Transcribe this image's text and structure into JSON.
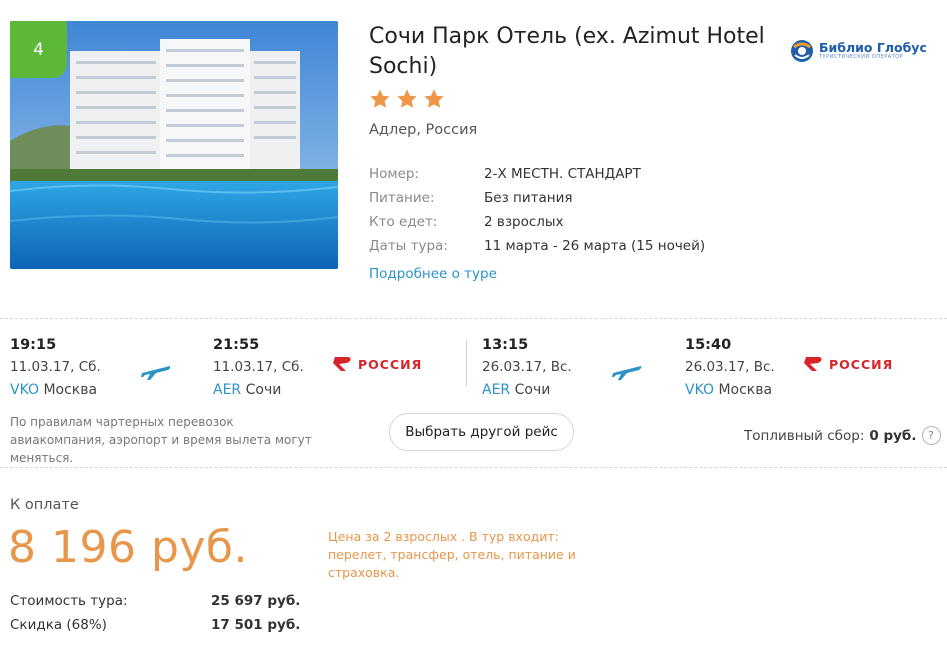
{
  "hotel": {
    "rank": "4",
    "name": "Сочи Парк Отель (ex. Azimut Hotel Sochi)",
    "stars": 3,
    "location": "Адлер, Россия",
    "details": [
      {
        "label": "Номер:",
        "value": "2-Х МЕСТН. СТАНДАРТ"
      },
      {
        "label": "Питание:",
        "value": "Без питания"
      },
      {
        "label": "Кто едет:",
        "value": "2 взрослых"
      },
      {
        "label": "Даты тура:",
        "value": "11 марта - 26 марта (15 ночей)"
      }
    ],
    "more_link": "Подробнее о туре"
  },
  "operator": {
    "name": "Библио Глобус",
    "subtitle": "ТУРИСТИЧЕСКИЙ ОПЕРАТОР",
    "brand_color": "#1f5ea8"
  },
  "flights": {
    "outbound": {
      "depart": {
        "time": "19:15",
        "date": "11.03.17, Сб.",
        "code": "VKO",
        "city": "Москва"
      },
      "arrive": {
        "time": "21:55",
        "date": "11.03.17, Сб.",
        "code": "AER",
        "city": "Сочи"
      },
      "airline": "РОССИЯ"
    },
    "return": {
      "depart": {
        "time": "13:15",
        "date": "26.03.17, Вс.",
        "code": "AER",
        "city": "Сочи"
      },
      "arrive": {
        "time": "15:40",
        "date": "26.03.17, Вс.",
        "code": "VKO",
        "city": "Москва"
      },
      "airline": "РОССИЯ"
    },
    "charter_note": "По правилам чартерных перевозок авиакомпания, аэропорт и время вылета могут меняться.",
    "change_button": "Выбрать другой рейс",
    "fuel_label": "Топливный сбор:",
    "fuel_value": "0 руб.",
    "help": "?"
  },
  "payment": {
    "label": "К оплате",
    "price": "8 196 руб.",
    "note": "Цена за 2 взрослых . В тур входит: перелет, трансфер, отель, питание и страховка.",
    "tour_cost_label": "Стоимость тура:",
    "tour_cost_value": "25 697 руб.",
    "discount_label": "Скидка (68%)",
    "discount_value": "17 501 руб.",
    "accent_color": "#e8964a"
  },
  "colors": {
    "link": "#2b93c8",
    "badge": "#5db83a",
    "star": "#f0964a",
    "airline": "#d6242b"
  }
}
